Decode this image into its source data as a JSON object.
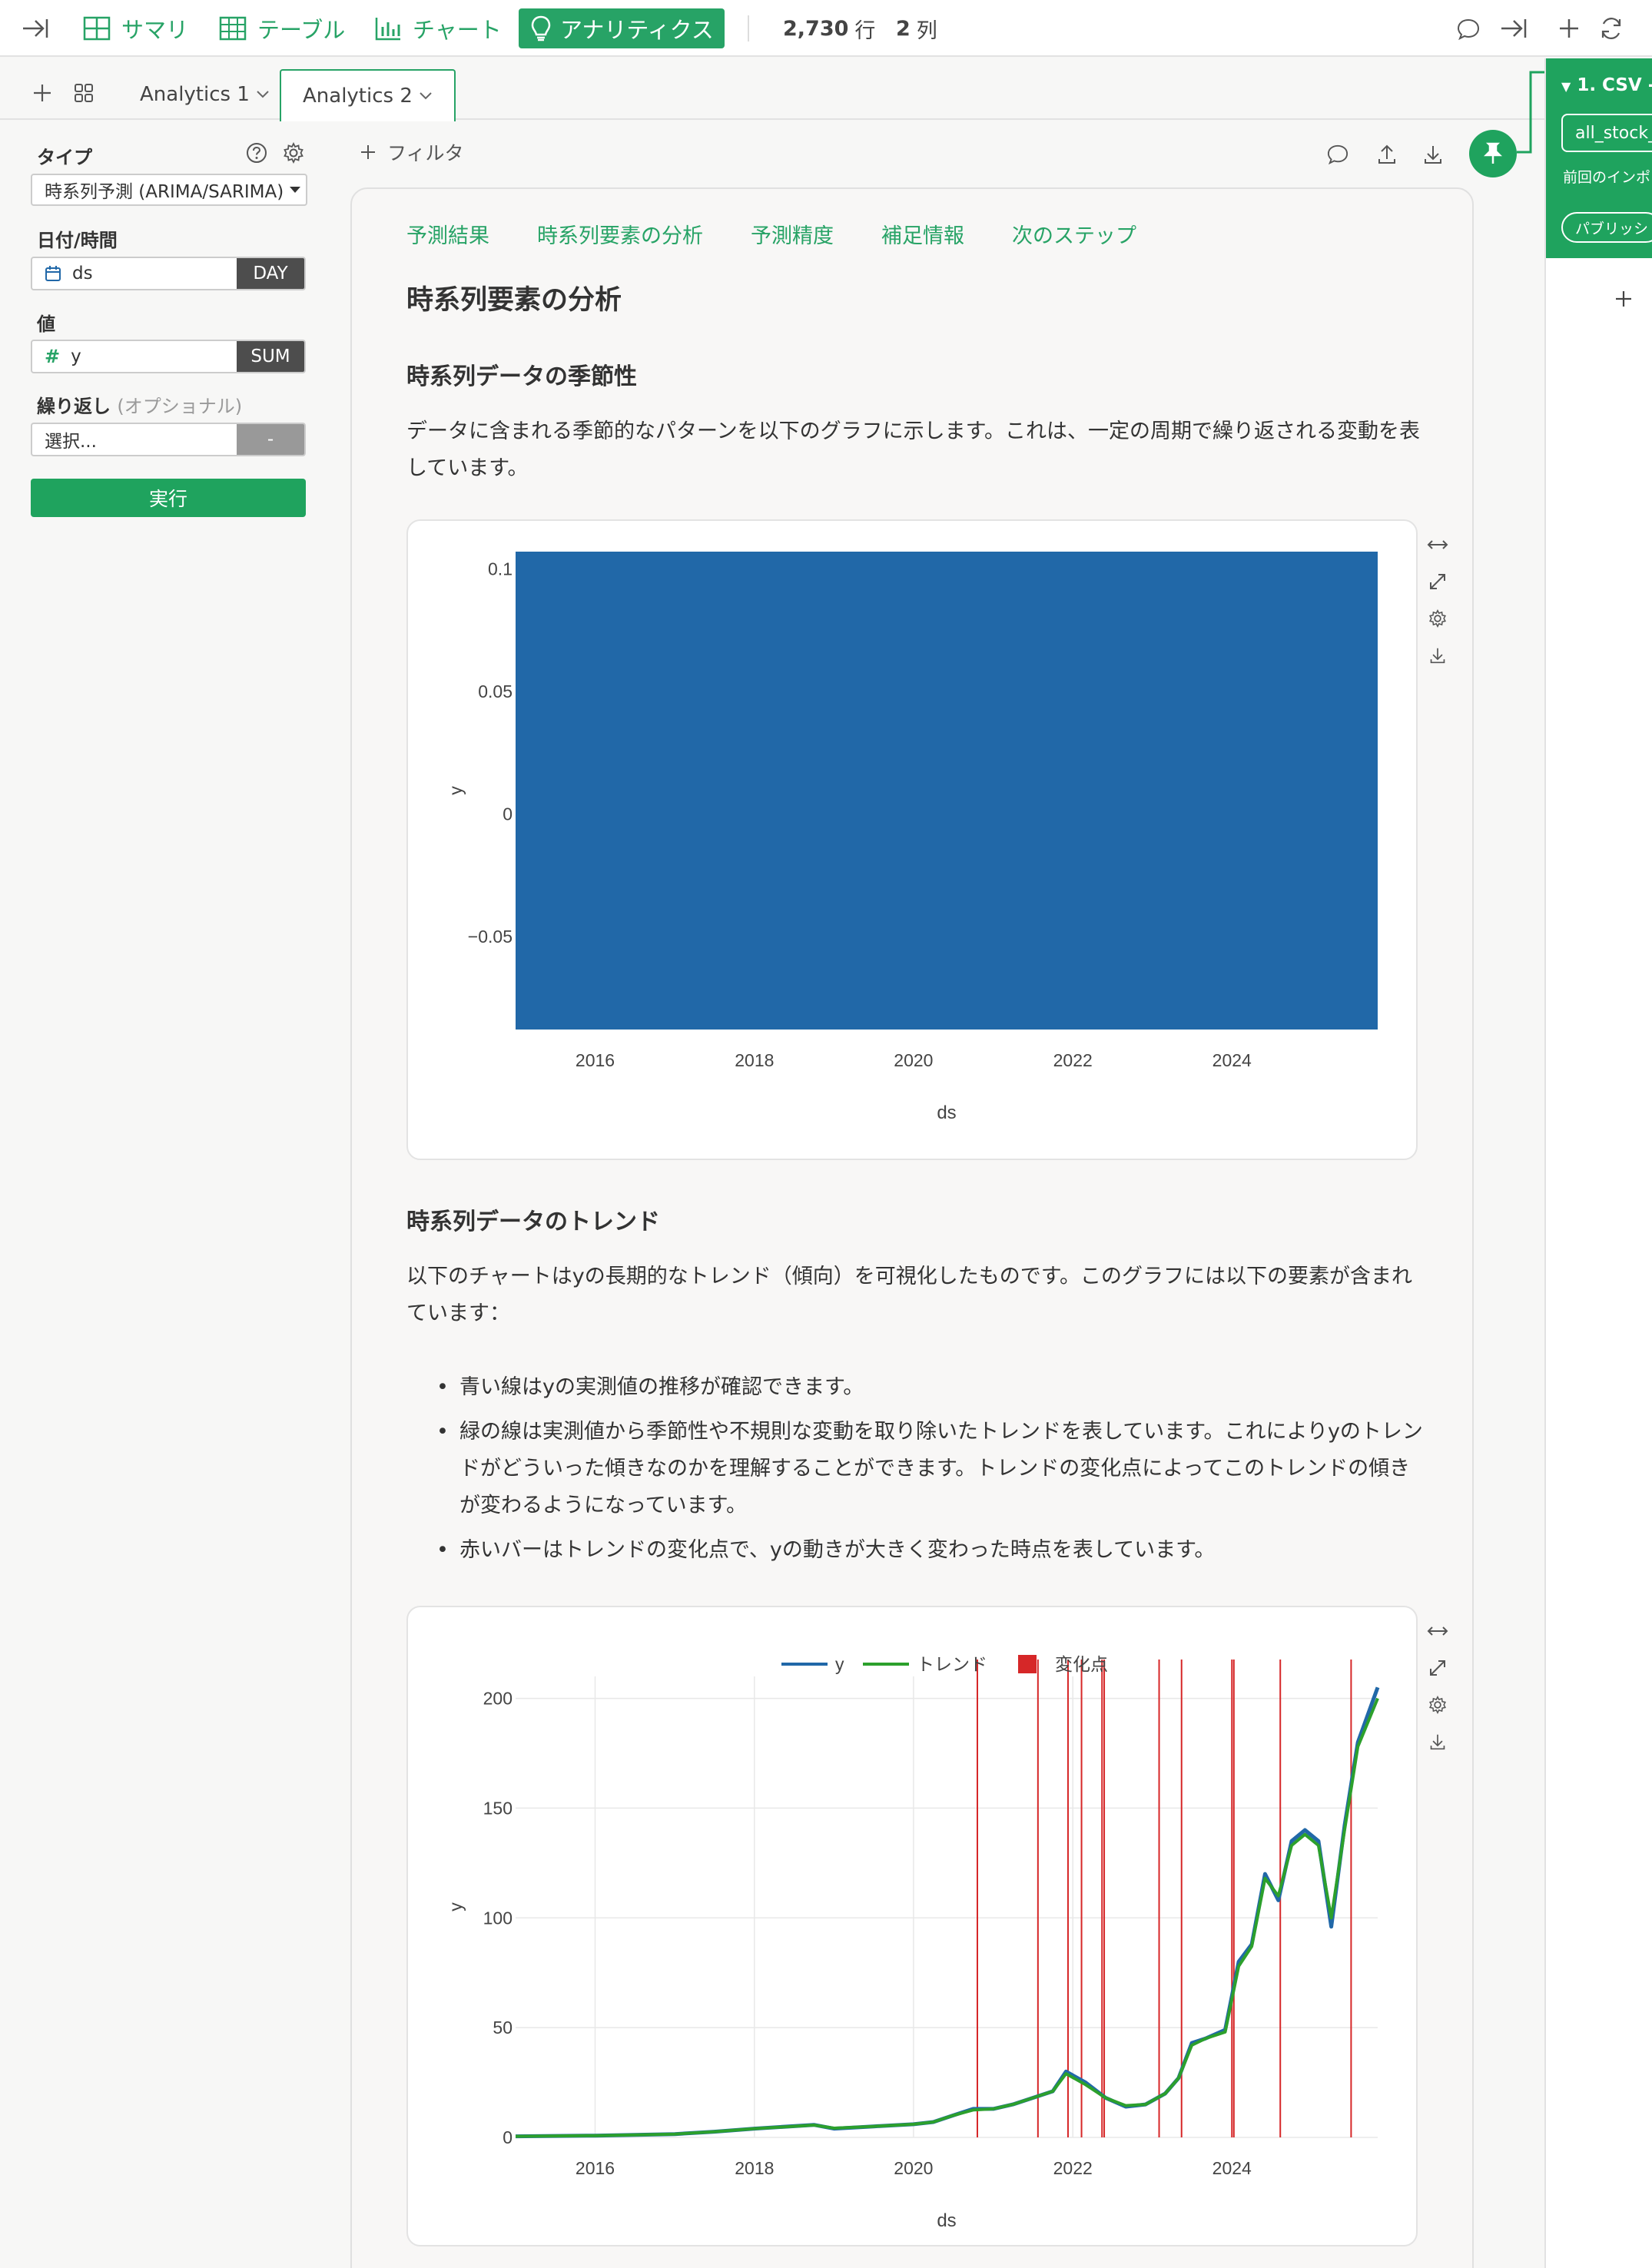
{
  "topbar": {
    "summary": "サマリ",
    "table": "テーブル",
    "chart": "チャート",
    "analytics": "アナリティクス",
    "rows_value": "2,730",
    "rows_unit": "行",
    "cols_value": "2",
    "cols_unit": "列"
  },
  "tabs": [
    {
      "label": "Analytics 1"
    },
    {
      "label": "Analytics 2"
    }
  ],
  "sidebar": {
    "type_label": "タイプ",
    "type_value": "時系列予測 (ARIMA/SARIMA)",
    "date_label": "日付/時間",
    "date_value": "ds",
    "date_agg": "DAY",
    "value_label": "値",
    "value_value": "y",
    "value_agg": "SUM",
    "repeat_label": "繰り返し",
    "repeat_optional": "(オプショナル)",
    "repeat_placeholder": "選択...",
    "repeat_agg": "-",
    "run_label": "実行"
  },
  "main": {
    "filter_label": "フィルタ",
    "subnav": [
      "予測結果",
      "時系列要素の分析",
      "予測精度",
      "補足情報",
      "次のステップ"
    ],
    "section_title": "時系列要素の分析",
    "seasonality_title": "時系列データの季節性",
    "seasonality_text": "データに含まれる季節的なパターンを以下のグラフに示します。これは、一定の周期で繰り返される変動を表しています。",
    "trend_title": "時系列データのトレンド",
    "trend_text": "以下のチャートはyの長期的なトレンド（傾向）を可視化したものです。このグラフには以下の要素が含まれています：",
    "bullets": [
      "青い線はyの実測値の推移が確認できます。",
      "緑の線は実測値から季節性や不規則な変動を取り除いたトレンドを表しています。これによりyのトレンドがどういった傾きなのかを理解することができます。トレンドの変化点によってこのトレンドの傾きが変わるようになっています。",
      "赤いバーはトレンドの変化点で、yの動きが大きく変わった時点を表しています。"
    ]
  },
  "right_panel": {
    "title": "1. CSV -",
    "input_value": "all_stock_",
    "note": "前回のインポ",
    "pill": "パブリッシ"
  },
  "chart_data": [
    {
      "type": "bar",
      "title": "",
      "xlabel": "ds",
      "ylabel": "y",
      "x_ticks": [
        "2016",
        "2018",
        "2020",
        "2022",
        "2024"
      ],
      "y_ticks": [
        "0.1",
        "0.05",
        "0",
        "−0.05"
      ],
      "xlim": [
        "2015-01-01",
        "2025-10-31"
      ],
      "ylim": [
        -0.088,
        0.107
      ],
      "series": [
        {
          "values": [
            {
              "x0": "2015-01-01",
              "x1": "2025-10-31",
              "y0": -0.088,
              "y1": 0.107
            }
          ],
          "color": "#2168a8"
        }
      ],
      "grid": true
    },
    {
      "type": "line",
      "title": "",
      "xlabel": "ds",
      "ylabel": "y",
      "x_ticks": [
        "2016",
        "2018",
        "2020",
        "2022",
        "2024"
      ],
      "y_ticks": [
        "200",
        "150",
        "100",
        "50",
        "0"
      ],
      "xlim": [
        "2015-01-01",
        "2025-10-31"
      ],
      "ylim": [
        0,
        210
      ],
      "legend": [
        "y",
        "トレンド",
        "変化点"
      ],
      "colors": {
        "y": "#2168a8",
        "trend": "#2ca02c",
        "changepoint": "#d62728"
      },
      "series": [
        {
          "name": "y",
          "x": [
            "2015-01-01",
            "2016-01-01",
            "2017-01-01",
            "2017-07-01",
            "2018-01-01",
            "2018-10-01",
            "2019-01-01",
            "2019-07-01",
            "2020-01-01",
            "2020-04-01",
            "2020-07-01",
            "2020-10-01",
            "2021-01-01",
            "2021-04-01",
            "2021-07-01",
            "2021-10-01",
            "2021-12-01",
            "2022-03-01",
            "2022-06-01",
            "2022-09-01",
            "2022-12-01",
            "2023-03-01",
            "2023-05-01",
            "2023-07-01",
            "2023-09-01",
            "2023-12-01",
            "2024-02-01",
            "2024-04-01",
            "2024-06-01",
            "2024-08-01",
            "2024-10-01",
            "2024-12-01",
            "2025-02-01",
            "2025-04-01",
            "2025-06-01",
            "2025-08-01",
            "2025-10-31"
          ],
          "values": [
            0.5,
            0.8,
            1.5,
            2.6,
            4,
            5.7,
            4,
            5,
            6,
            7,
            10,
            13,
            13,
            15,
            18,
            21,
            30,
            25,
            18,
            14,
            15,
            20,
            27,
            43,
            45,
            49,
            80,
            88,
            120,
            108,
            135,
            140,
            135,
            96,
            142,
            180,
            205
          ]
        },
        {
          "name": "トレンド",
          "x": [
            "2015-01-01",
            "2016-01-01",
            "2017-01-01",
            "2017-07-01",
            "2018-01-01",
            "2018-10-01",
            "2019-01-01",
            "2019-07-01",
            "2020-01-01",
            "2020-04-01",
            "2020-07-01",
            "2020-10-01",
            "2021-01-01",
            "2021-04-01",
            "2021-07-01",
            "2021-10-01",
            "2021-12-01",
            "2022-03-01",
            "2022-06-01",
            "2022-09-01",
            "2022-12-01",
            "2023-03-01",
            "2023-05-01",
            "2023-07-01",
            "2023-09-01",
            "2023-12-01",
            "2024-02-01",
            "2024-04-01",
            "2024-06-01",
            "2024-08-01",
            "2024-10-01",
            "2024-12-01",
            "2025-02-01",
            "2025-04-01",
            "2025-06-01",
            "2025-08-01",
            "2025-10-31"
          ],
          "values": [
            0.5,
            0.8,
            1.5,
            2.6,
            4,
            5.6,
            4.2,
            5,
            6,
            7,
            10,
            12.5,
            13,
            15,
            18,
            21,
            29,
            24,
            18,
            14.5,
            15,
            20,
            27,
            42,
            45,
            48,
            78,
            87,
            118,
            110,
            133,
            138,
            133,
            100,
            140,
            178,
            200
          ]
        },
        {
          "name": "変化点",
          "x": [
            "2020-10-20",
            "2021-07-25",
            "2021-12-10",
            "2022-02-10",
            "2022-05-15",
            "2022-05-25",
            "2023-02-01",
            "2023-05-15",
            "2024-01-01",
            "2024-01-10",
            "2024-08-10",
            "2025-07-01"
          ]
        }
      ],
      "grid": true
    }
  ]
}
